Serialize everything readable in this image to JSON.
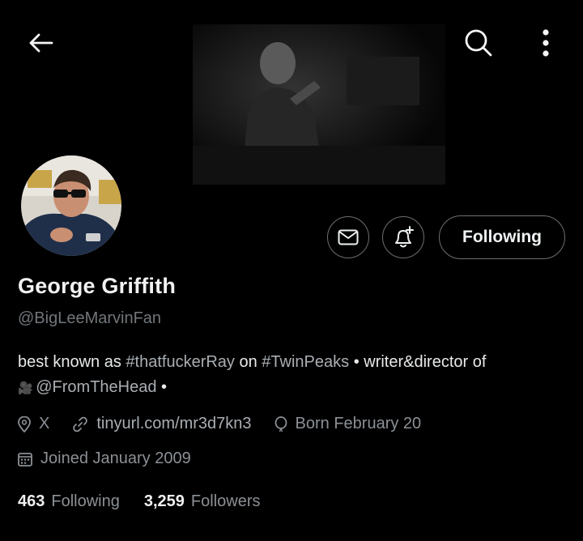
{
  "header": {
    "back_icon": "arrow-left-icon",
    "search_icon": "search-icon",
    "more_icon": "more-vertical-icon"
  },
  "profile": {
    "display_name": "George Griffith",
    "handle": "@BigLeeMarvinFan",
    "follow_button_label": "Following",
    "message_icon": "envelope-icon",
    "notify_icon": "bell-plus-icon"
  },
  "bio": {
    "line1_prefix": "best known as ",
    "hashtag1": "#thatfuckerRay",
    "line1_mid": " on ",
    "hashtag2": "#TwinPeaks",
    "line1_suffix": " • writer&director of",
    "line2_emoji": "🎥",
    "mention": "@FromTheHead",
    "line2_suffix": " •"
  },
  "meta": {
    "location": "X",
    "website": "tinyurl.com/mr3d7kn3",
    "birthday": "Born February 20",
    "joined": "Joined January 2009"
  },
  "stats": {
    "following_count": "463",
    "following_label": "Following",
    "followers_count": "3,259",
    "followers_label": "Followers"
  },
  "colors": {
    "background": "#000000",
    "text_primary": "#e7e9ea",
    "text_secondary": "#71767b",
    "border": "#6b6f73"
  }
}
